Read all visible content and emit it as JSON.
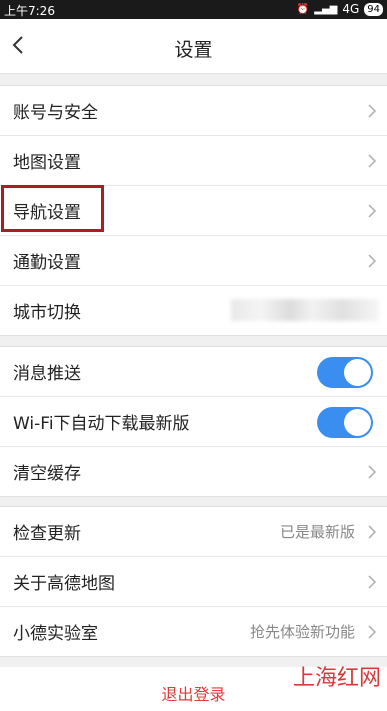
{
  "status_bar": {
    "time": "上午7:26",
    "network": "4G",
    "battery": "94"
  },
  "header": {
    "title": "设置"
  },
  "groups": [
    {
      "items": [
        {
          "label": "账号与安全"
        },
        {
          "label": "地图设置"
        },
        {
          "label": "导航设置"
        },
        {
          "label": "通勤设置"
        },
        {
          "label": "城市切换"
        }
      ]
    },
    {
      "items": [
        {
          "label": "消息推送",
          "toggle": true
        },
        {
          "label": "Wi-Fi下自动下载最新版",
          "toggle": true
        },
        {
          "label": "清空缓存"
        }
      ]
    },
    {
      "items": [
        {
          "label": "检查更新",
          "value": "已是最新版"
        },
        {
          "label": "关于高德地图"
        },
        {
          "label": "小德实验室",
          "value": "抢先体验新功能"
        }
      ]
    }
  ],
  "logout": {
    "label": "退出登录"
  },
  "watermark": "上海红网",
  "colors": {
    "toggle_on": "#3a8ef0",
    "highlight_box": "#a81e22",
    "logout_text": "#e23b3b"
  }
}
